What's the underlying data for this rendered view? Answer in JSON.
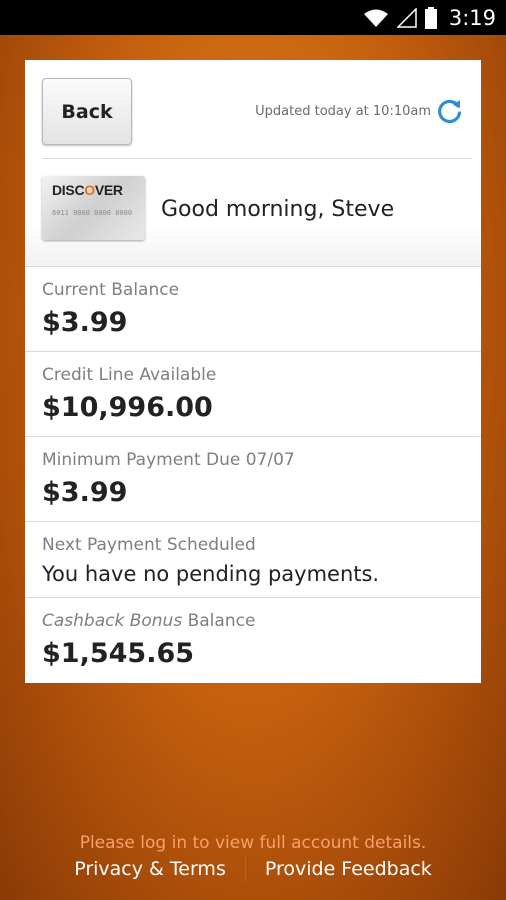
{
  "status_bar": {
    "time": "3:19"
  },
  "header": {
    "back_label": "Back",
    "updated_text": "Updated today at 10:10am",
    "greeting": "Good morning, Steve",
    "card_brand": "DISCOVER",
    "card_number": "6011 0000 0000 0000"
  },
  "rows": [
    {
      "label": "Current Balance",
      "value": "$3.99"
    },
    {
      "label": "Credit Line Available",
      "value": "$10,996.00"
    },
    {
      "label": "Minimum Payment Due 07/07",
      "value": "$3.99"
    },
    {
      "label": "Next Payment Scheduled",
      "value": "You have no pending payments."
    },
    {
      "label_italic": "Cashback Bonus",
      "label_rest": " Balance",
      "value": "$1,545.65"
    }
  ],
  "footer": {
    "message": "Please log in to view full account details.",
    "privacy_label": "Privacy & Terms",
    "feedback_label": "Provide Feedback"
  },
  "colors": {
    "accent": "#2d8fd0",
    "footer_message": "#f6a26a",
    "background": "#c8610e"
  }
}
